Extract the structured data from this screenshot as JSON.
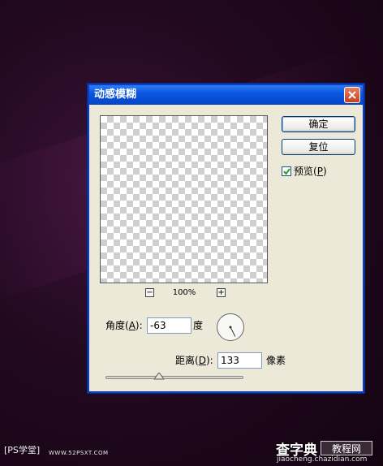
{
  "dialog": {
    "title": "动感模糊",
    "ok_label": "确定",
    "reset_label": "复位",
    "preview_checkbox": {
      "label_prefix": "预览(",
      "label_key": "P",
      "label_suffix": ")",
      "checked": true
    },
    "zoom": {
      "minus": "−",
      "level": "100%",
      "plus": "+"
    },
    "angle": {
      "label_prefix": "角度(",
      "label_key": "A",
      "label_suffix": "):",
      "value": "-63",
      "unit": "度",
      "degrees": -63
    },
    "distance": {
      "label_prefix": "距离(",
      "label_key": "D",
      "label_suffix": "):",
      "value": "133",
      "unit": "像素",
      "slider_fraction": 0.39
    }
  },
  "watermarks": {
    "left_logo": "PS学堂",
    "left_url": "WWW.52PSXT.COM",
    "right_cn": "查字典",
    "right_box": "教程网",
    "right_url": "jiaocheng.chazidian.com"
  }
}
